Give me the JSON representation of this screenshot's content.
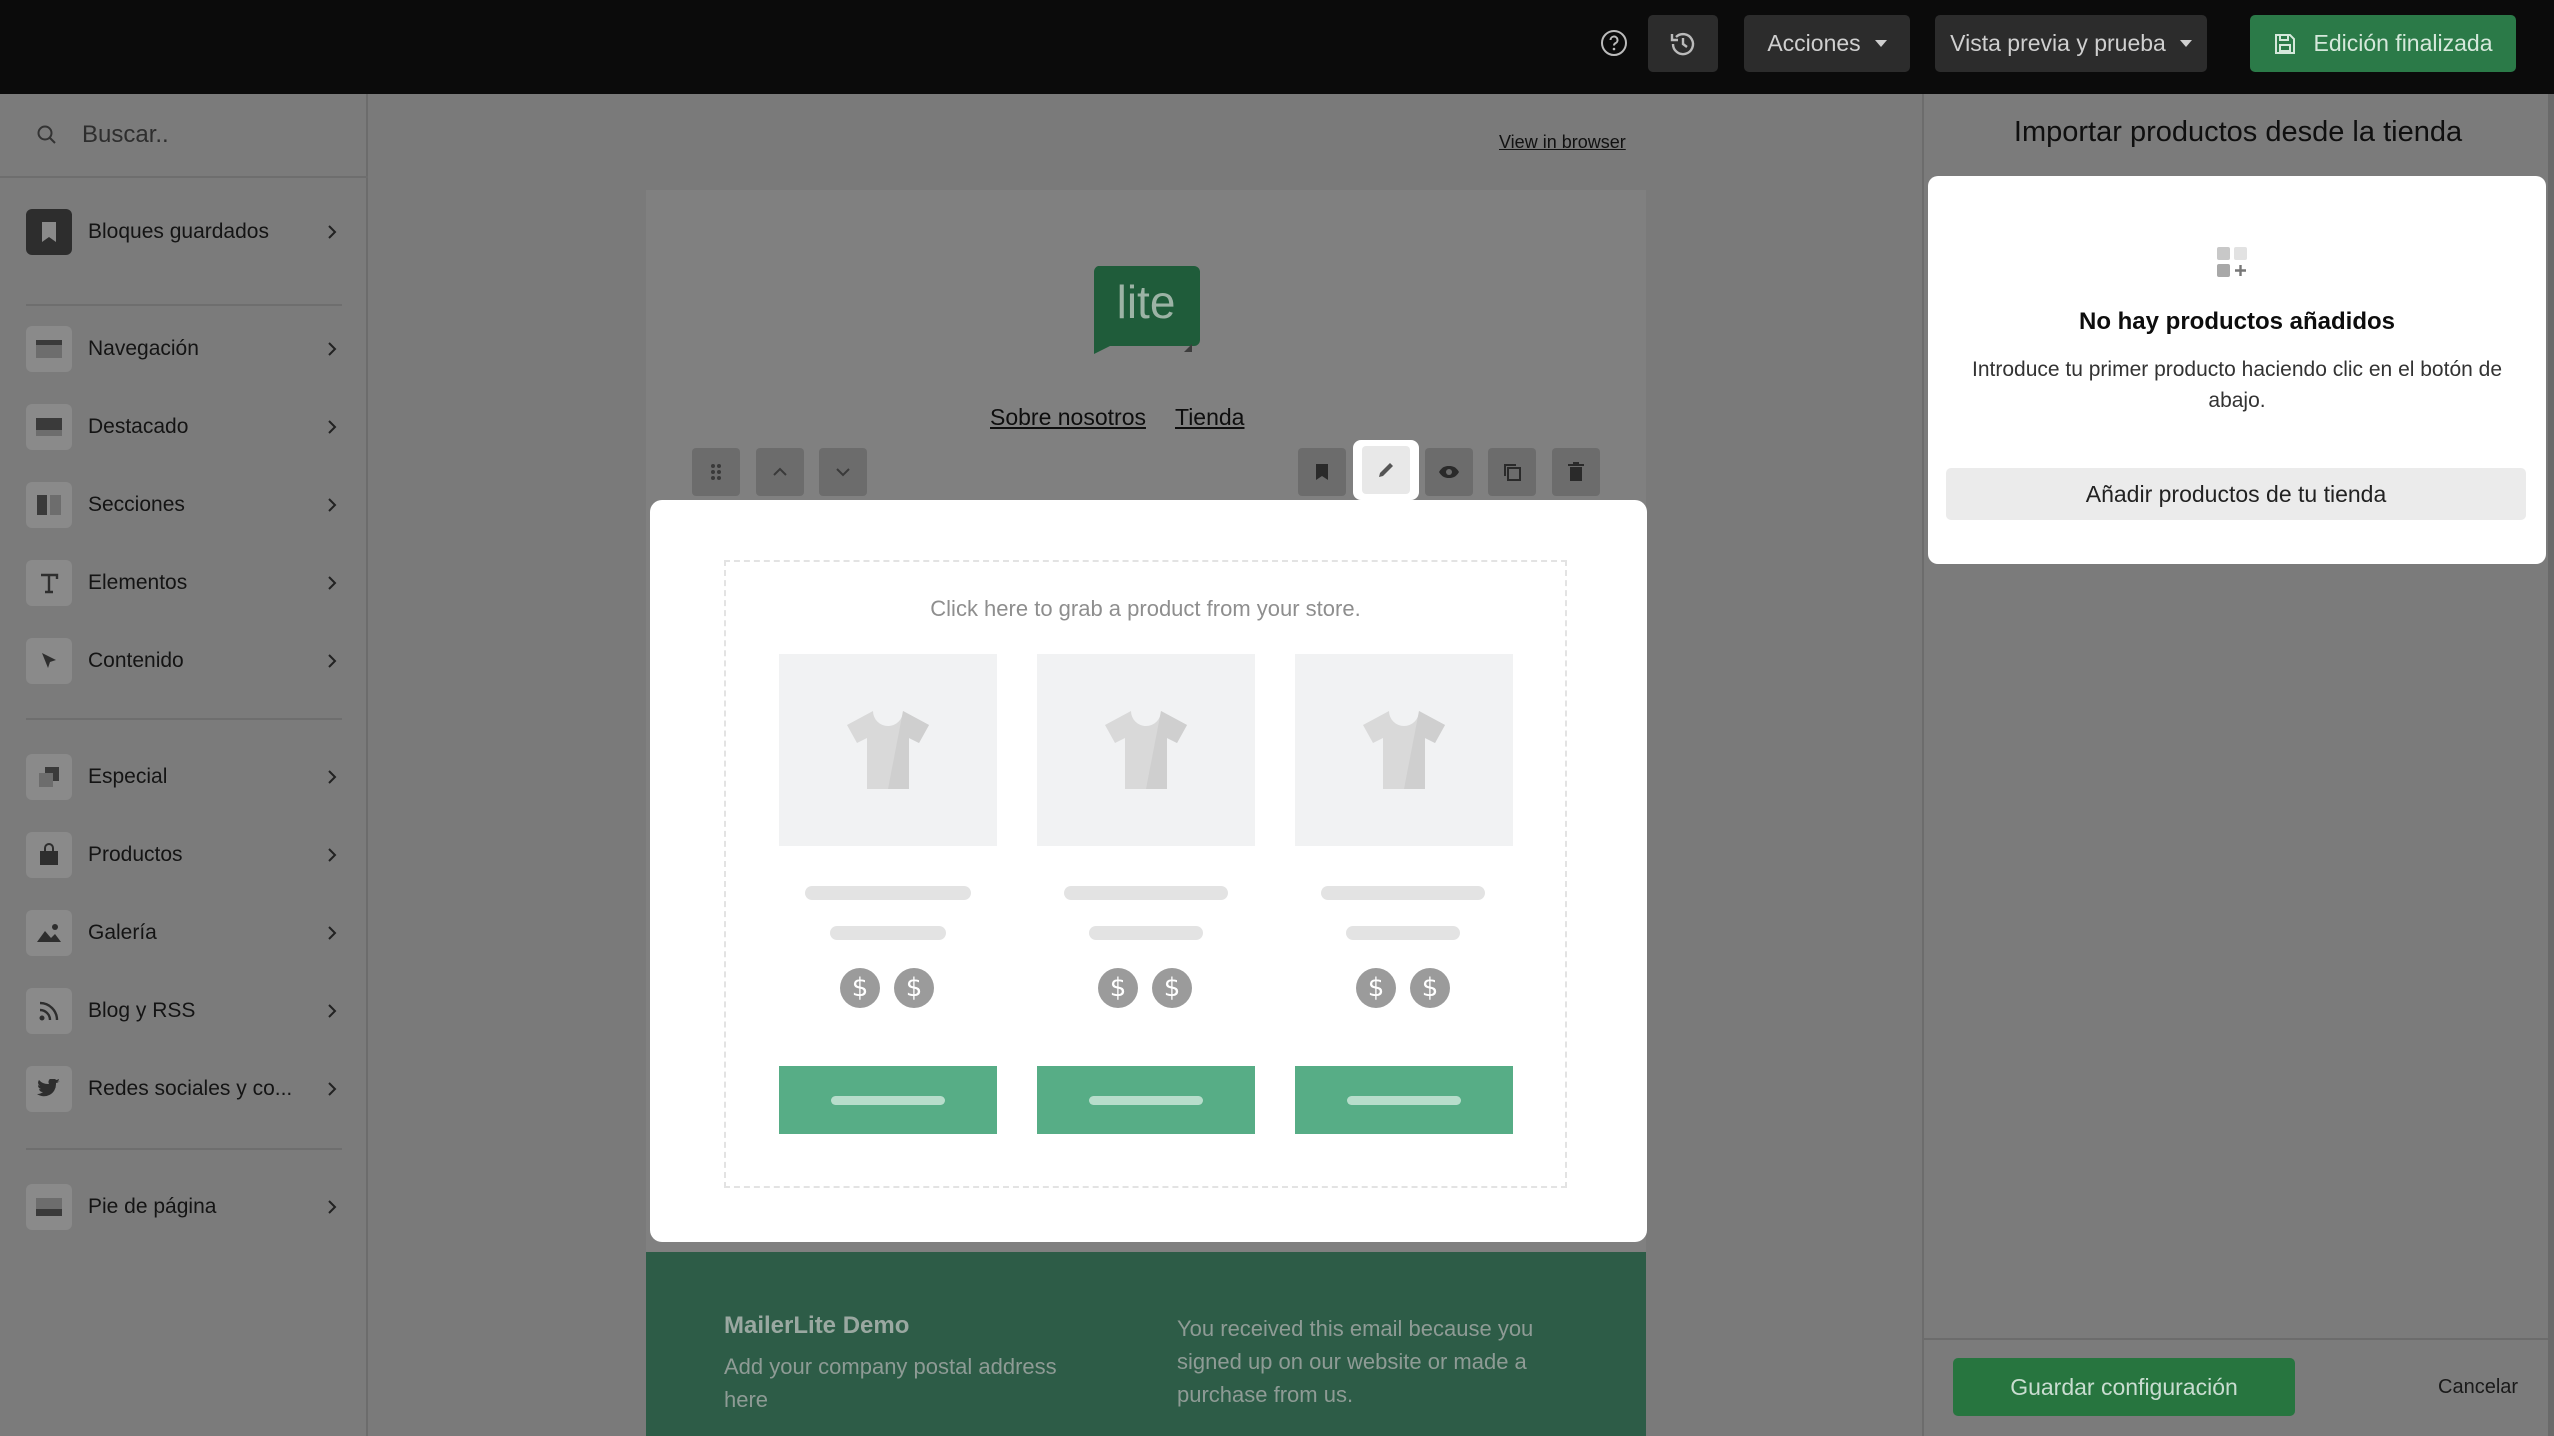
{
  "topbar": {
    "actions_label": "Acciones",
    "preview_label": "Vista previa y prueba",
    "done_label": "Edición finalizada",
    "icons": [
      "help-circle-icon",
      "history-icon",
      "save-icon"
    ]
  },
  "sidebar": {
    "search_placeholder": "Buscar..",
    "items": [
      {
        "label": "Bloques guardados",
        "icon": "bookmark-icon"
      },
      {
        "label": "Navegación",
        "icon": "navigation-icon"
      },
      {
        "label": "Destacado",
        "icon": "featured-icon"
      },
      {
        "label": "Secciones",
        "icon": "sections-icon"
      },
      {
        "label": "Elementos",
        "icon": "text-icon"
      },
      {
        "label": "Contenido",
        "icon": "cursor-icon"
      },
      {
        "label": "Especial",
        "icon": "special-icon"
      },
      {
        "label": "Productos",
        "icon": "bag-icon"
      },
      {
        "label": "Galería",
        "icon": "image-icon"
      },
      {
        "label": "Blog y RSS",
        "icon": "rss-icon"
      },
      {
        "label": "Redes sociales y co...",
        "icon": "twitter-icon"
      },
      {
        "label": "Pie de página",
        "icon": "footer-icon"
      }
    ]
  },
  "canvas": {
    "view_in_browser": "View in browser",
    "logo_text": "lite",
    "menu": [
      "Sobre nosotros",
      "Tienda"
    ],
    "product_block": {
      "grab_text": "Click here to grab a product from your store.",
      "currency_symbol": "$"
    },
    "footer": {
      "company": "MailerLite Demo",
      "address": "Add your company postal address here",
      "note": "You received this email because you signed up on our website or made a purchase from us."
    }
  },
  "right_panel": {
    "title": "Importar productos desde la tienda",
    "empty_title": "No hay productos añadidos",
    "empty_desc": "Introduce tu primer producto haciendo clic en el botón de abajo.",
    "add_button": "Añadir productos de tu tienda",
    "save_button": "Guardar configuración",
    "cancel": "Cancelar"
  },
  "colors": {
    "brand_green": "#2b7a48",
    "product_button": "#57ad86",
    "footer_bg": "#2d5c47"
  }
}
